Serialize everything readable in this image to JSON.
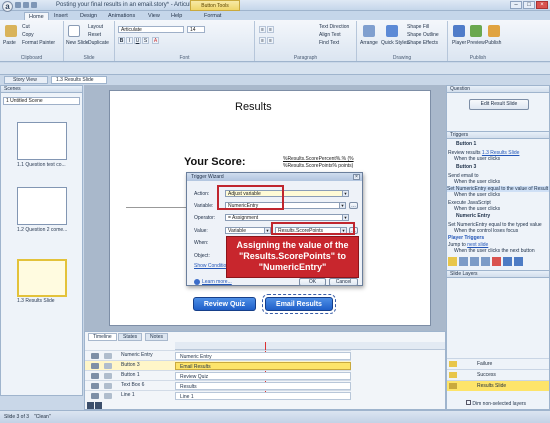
{
  "window": {
    "title": "Posting your final results in an email.story* - Articulate Storyline",
    "context_tab": "Button Tools"
  },
  "menu_tabs": [
    "Home",
    "Insert",
    "Design",
    "Animations",
    "View",
    "Help",
    "Format"
  ],
  "ribbon": {
    "clipboard": {
      "paste": "Paste",
      "cut": "Cut",
      "copy": "Copy",
      "format_painter": "Format Painter",
      "group": "Clipboard"
    },
    "slide": {
      "new_slide": "New Slide",
      "layout": "Layout",
      "reset": "Reset",
      "duplicate": "Duplicate",
      "group": "Slide"
    },
    "font": {
      "family": "Articulate",
      "size": "14",
      "group": "Font"
    },
    "paragraph": {
      "text_direction": "Text Direction",
      "align_text": "Align Text",
      "find_text": "Find Text",
      "group": "Paragraph"
    },
    "drawing": {
      "arrange": "Arrange",
      "quick_styles": "Quick Styles",
      "shape_fill": "Shape Fill",
      "shape_outline": "Shape Outline",
      "shape_effects": "Shape Effects",
      "group": "Drawing"
    },
    "publish": {
      "player": "Player",
      "preview": "Preview",
      "publish": "Publish",
      "group": "Publish"
    }
  },
  "story_view_tab": "Story View",
  "slide_tab": "1.3 Results Slide",
  "scenes": {
    "header": "Scenes",
    "dropdown": "1 Untitled Scene",
    "thumbnails": [
      {
        "label": "1.1 Question text co..."
      },
      {
        "label": "1.2 Question 2 come..."
      },
      {
        "label": "1.3 Results Slide"
      }
    ]
  },
  "slide": {
    "title": "Results",
    "score_label": "Your Score:",
    "score_var1": "%Results.ScorePercent%.% (%",
    "score_var2": "%Results.ScorePoints% points)",
    "review_button": "Review Quiz",
    "email_button": "Email Results"
  },
  "dialog": {
    "title": "Trigger Wizard",
    "action_label": "Action:",
    "action_value": "Adjust variable",
    "variable_label": "Variable:",
    "variable_value": "NumericEntry",
    "operator_label": "Operator:",
    "operator_value": "= Assignment",
    "value_label": "Value:",
    "value_type": "Variable",
    "value_value": "Results.ScorePoints",
    "when_label": "When:",
    "object_label": "Object:",
    "show_conditions": "Show Conditions",
    "learn_more": "Learn more...",
    "ok": "OK",
    "cancel": "Cancel"
  },
  "callout": "Assigning the value of the \"Results.ScorePoints\" to \"NumericEntry\"",
  "timeline": {
    "tabs": [
      "Timeline",
      "States",
      "Notes"
    ],
    "rows": [
      {
        "name": "Numeric Entry",
        "bar": "Numeric Entry",
        "highlight": false
      },
      {
        "name": "Button 3",
        "bar": "Email Results",
        "highlight": true
      },
      {
        "name": "Button 1",
        "bar": "Review Quiz",
        "highlight": false
      },
      {
        "name": "Text Box 6",
        "bar": "Results",
        "highlight": false
      },
      {
        "name": "Line 1",
        "bar": "Line 1",
        "highlight": false
      }
    ]
  },
  "right_panel": {
    "question_header": "Question",
    "edit_result_slide": "Edit Result Slide",
    "triggers_header": "Triggers",
    "button1": "Button 1",
    "t1a": "Review results",
    "t1a_link": "1.3 Results Slide",
    "t1b": "When the user clicks",
    "button3": "Button 3",
    "t3a": "Send email to",
    "t3b": "When the user clicks",
    "t3c": "Set NumericEntry equal to the value of Result",
    "t3d": "When the user clicks",
    "t3e": "Execute JavaScript",
    "t3f": "When the user clicks",
    "numeric_entry": "Numeric Entry",
    "t4a": "Set NumericEntry equal to the typed value",
    "t4b": "When the control loses focus",
    "player_triggers": "Player Triggers",
    "t5a": "Jump to",
    "t5a_link": "next slide",
    "t5b": "When the user clicks the next button",
    "slide_layers_header": "Slide Layers",
    "layers": [
      "Failure",
      "Success",
      "Results Slide"
    ],
    "dim_label": "Dim non-selected layers"
  },
  "status": {
    "slide_info": "Slide 3 of 3",
    "theme": "\"Clean\""
  }
}
